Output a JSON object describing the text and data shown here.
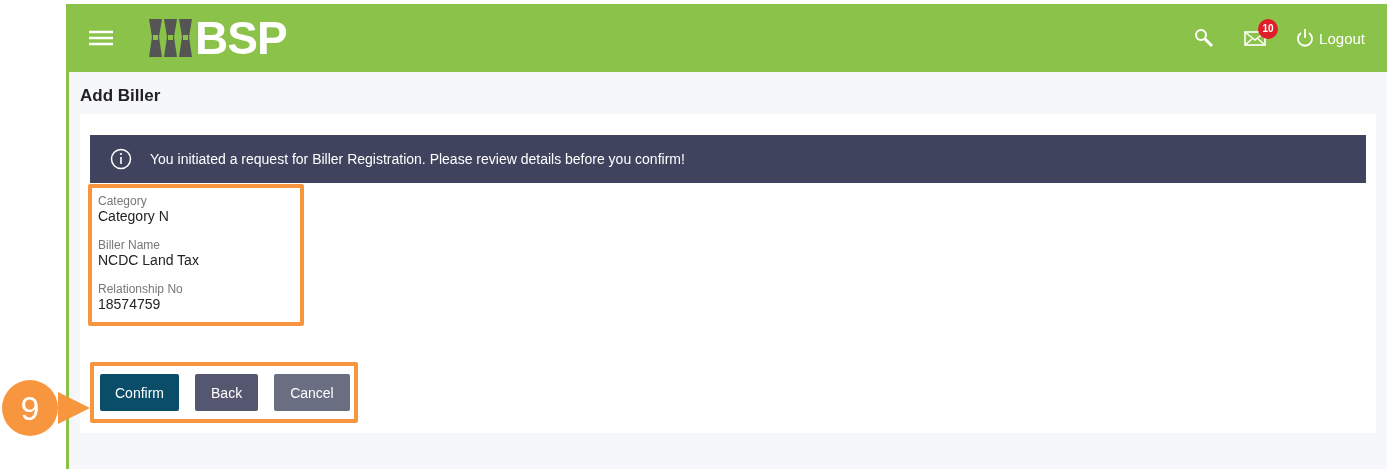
{
  "header": {
    "logo": "BSP",
    "notification_count": "10",
    "logout": "Logout"
  },
  "page_title": "Add Biller",
  "banner": {
    "message": "You initiated a request for Biller Registration. Please review details before you confirm!"
  },
  "details": [
    {
      "label": "Category",
      "value": "Category N"
    },
    {
      "label": "Biller Name",
      "value": "NCDC Land Tax"
    },
    {
      "label": "Relationship No",
      "value": "18574759"
    }
  ],
  "buttons": [
    {
      "label": "Confirm",
      "kind": "primary"
    },
    {
      "label": "Back",
      "kind": "secondary"
    },
    {
      "label": "Cancel",
      "kind": "tertiary"
    }
  ],
  "step_marker": {
    "label": "9"
  }
}
